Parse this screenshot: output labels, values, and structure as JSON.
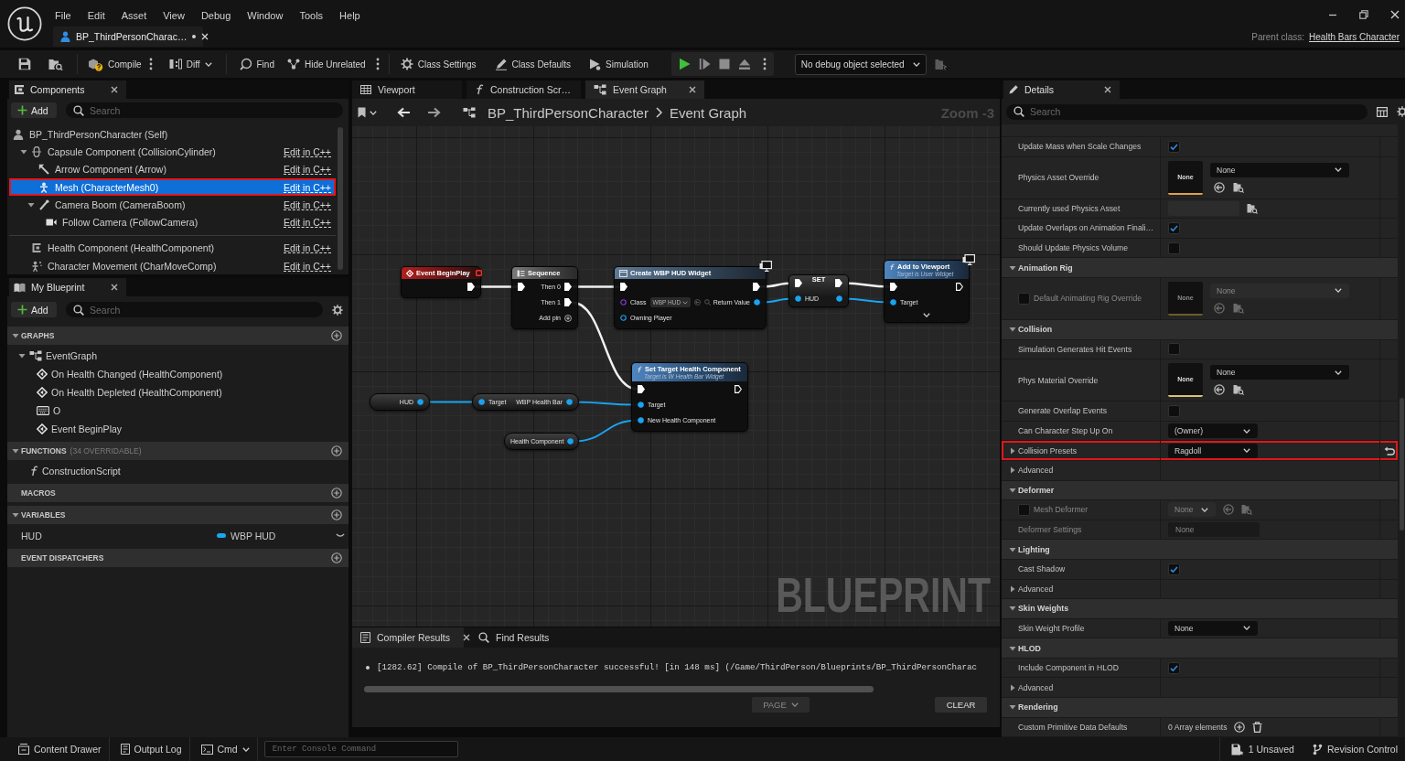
{
  "menu_bar": [
    "File",
    "Edit",
    "Asset",
    "View",
    "Debug",
    "Window",
    "Tools",
    "Help"
  ],
  "document_tab": {
    "label": "BP_ThirdPersonCharac…",
    "modified": true
  },
  "parent_class": {
    "label": "Parent class:",
    "value": "Health Bars Character"
  },
  "toolbar": {
    "compile": "Compile",
    "diff": "Diff",
    "find": "Find",
    "hide_unrelated": "Hide Unrelated",
    "class_settings": "Class Settings",
    "class_defaults": "Class Defaults",
    "simulation": "Simulation",
    "debug_object": "No debug object selected"
  },
  "components": {
    "tab": "Components",
    "add_button": "Add",
    "search_placeholder": "Search",
    "root": {
      "kind": "actor",
      "label": "BP_ThirdPersonCharacter (Self)",
      "selected": false,
      "outlined": false,
      "children": [
        {
          "kind": "capsule",
          "label": "Capsule Component (CollisionCylinder)",
          "link": "Edit in C++",
          "selected": false,
          "outlined": false,
          "expanded": true,
          "children": [
            {
              "kind": "arrow",
              "label": "Arrow Component (Arrow)",
              "link": "Edit in C++",
              "selected": false,
              "outlined": false
            },
            {
              "kind": "mesh",
              "label": "Mesh (CharacterMesh0)",
              "link": "Edit in C++",
              "selected": true,
              "outlined": true
            },
            {
              "kind": "boom",
              "label": "Camera Boom (CameraBoom)",
              "link": "Edit in C++",
              "selected": false,
              "outlined": false,
              "expanded": true,
              "children": [
                {
                  "kind": "camera",
                  "label": "Follow Camera (FollowCamera)",
                  "link": "Edit in C++",
                  "selected": false,
                  "outlined": false
                }
              ]
            }
          ]
        }
      ]
    },
    "actor_components": [
      {
        "kind": "health",
        "label": "Health Component (HealthComponent)",
        "link": "Edit in C++",
        "selected": false,
        "outlined": false
      },
      {
        "kind": "movement",
        "label": "Character Movement (CharMoveComp)",
        "link": "Edit in C++",
        "selected": false,
        "outlined": false
      }
    ]
  },
  "my_blueprint": {
    "tab": "My Blueprint",
    "add_button": "Add",
    "search_placeholder": "Search",
    "sections": [
      {
        "title": "GRAPHS",
        "expanded": true,
        "items": [
          {
            "kind": "graph",
            "label": "EventGraph",
            "expanded": true,
            "children": [
              {
                "kind": "event",
                "label": "On Health Changed (HealthComponent)"
              },
              {
                "kind": "event",
                "label": "On Health Depleted (HealthComponent)"
              },
              {
                "kind": "key",
                "label": "O"
              },
              {
                "kind": "event",
                "label": "Event BeginPlay"
              }
            ]
          }
        ]
      },
      {
        "title": "FUNCTIONS",
        "note": "(34 OVERRIDABLE)",
        "expanded": true,
        "items": [
          {
            "kind": "function",
            "label": "ConstructionScript"
          }
        ]
      },
      {
        "title": "MACROS"
      },
      {
        "title": "VARIABLES",
        "expanded": true,
        "items": [
          {
            "kind": "variable",
            "label": "HUD",
            "type": "WBP HUD",
            "color": "#1aa6ee"
          }
        ]
      },
      {
        "title": "EVENT DISPATCHERS"
      }
    ]
  },
  "graph_editor": {
    "tabs": [
      {
        "kind": "viewport",
        "label": "Viewport",
        "selected": false
      },
      {
        "kind": "function",
        "label": "Construction Scr…",
        "selected": false
      },
      {
        "kind": "graph",
        "label": "Event Graph",
        "selected": true
      }
    ],
    "breadcrumb": [
      "BP_ThirdPersonCharacter",
      "Event Graph"
    ],
    "zoom": "Zoom -3",
    "corner_label": "BLUEPRINT",
    "nodes": [
      {
        "kind": "event",
        "title": "Event BeginPlay",
        "outputs": [
          {
            "kind": "exec",
            "connected": true
          }
        ]
      },
      {
        "kind": "sequence",
        "title": "Sequence",
        "inputs": [
          {
            "kind": "exec",
            "connected": true
          }
        ],
        "outputs": [
          {
            "kind": "exec",
            "label": "Then 0",
            "connected": true
          },
          {
            "kind": "exec",
            "label": "Then 1",
            "connected": true
          }
        ],
        "add_pin": "Add pin"
      },
      {
        "kind": "create",
        "title": "Create WBP HUD Widget",
        "cosmetic": true,
        "inputs": [
          {
            "kind": "exec",
            "connected": true
          },
          {
            "kind": "class",
            "label": "Class",
            "value": "WBP HUD",
            "connected": false
          },
          {
            "kind": "object",
            "label": "Owning Player",
            "connected": false
          }
        ],
        "outputs": [
          {
            "kind": "exec",
            "connected": true
          },
          {
            "kind": "object",
            "label": "Return Value",
            "connected": true
          }
        ]
      },
      {
        "kind": "set",
        "title": "SET",
        "inputs": [
          {
            "kind": "exec",
            "connected": true
          },
          {
            "kind": "object",
            "label": "HUD",
            "connected": true
          }
        ],
        "outputs": [
          {
            "kind": "exec",
            "connected": true
          },
          {
            "kind": "object",
            "connected": true
          }
        ]
      },
      {
        "kind": "function",
        "title": "Add to Viewport",
        "subtitle": "Target is User Widget",
        "cosmetic": true,
        "advanced_expanded": false,
        "inputs": [
          {
            "kind": "exec",
            "connected": true
          },
          {
            "kind": "object",
            "label": "Target",
            "connected": true
          }
        ],
        "outputs": [
          {
            "kind": "exec",
            "connected": false
          }
        ]
      },
      {
        "kind": "function",
        "title": "Set Target Health Component",
        "subtitle": "Target is W Health Bar Widget",
        "cosmetic": false,
        "inputs": [
          {
            "kind": "exec",
            "connected": true
          },
          {
            "kind": "object",
            "label": "Target",
            "connected": true
          },
          {
            "kind": "object",
            "label": "New Health Component",
            "connected": true
          }
        ],
        "outputs": [
          {
            "kind": "exec",
            "connected": false
          }
        ]
      },
      {
        "kind": "getter",
        "outputs": [
          {
            "kind": "object",
            "label": "HUD",
            "connected": true
          }
        ]
      },
      {
        "kind": "getter",
        "inputs": [
          {
            "kind": "object",
            "label": "Target",
            "connected": true
          }
        ],
        "outputs": [
          {
            "kind": "object",
            "label": "WBP Health Bar",
            "connected": true
          }
        ]
      },
      {
        "kind": "getter",
        "outputs": [
          {
            "kind": "object",
            "label": "Health Component",
            "connected": true
          }
        ]
      }
    ]
  },
  "compiler_results": {
    "tabs": [
      {
        "kind": "results",
        "label": "Compiler Results",
        "selected": true
      },
      {
        "kind": "search",
        "label": "Find Results",
        "selected": false
      }
    ],
    "messages": [
      "[1282.62] Compile of BP_ThirdPersonCharacter successful! [in 148 ms] (/Game/ThirdPerson/Blueprints/BP_ThirdPersonCharac"
    ],
    "page_button": {
      "label": "PAGE",
      "disabled": true
    },
    "clear_button": "CLEAR"
  },
  "details": {
    "tab": "Details",
    "search_placeholder": "Search",
    "items": [
      {
        "kind": "checkbox",
        "label": "Update Mass when Scale Changes",
        "checked": true,
        "disabled": false,
        "outlined": false
      },
      {
        "kind": "asset",
        "label": "Physics Asset Override",
        "thumbnail": "None",
        "value": "None",
        "color": "#e3a04b",
        "disabled": false,
        "outlined": false
      },
      {
        "kind": "asset_path",
        "label": "Currently used Physics Asset",
        "disabled": false,
        "outlined": false
      },
      {
        "kind": "checkbox",
        "label": "Update Overlaps on Animation Finali…",
        "checked": true,
        "disabled": false,
        "outlined": false
      },
      {
        "kind": "checkbox",
        "label": "Should Update Physics Volume",
        "checked": false,
        "disabled": false,
        "outlined": false
      },
      {
        "kind": "section",
        "label": "Animation Rig",
        "expanded": true
      },
      {
        "kind": "asset",
        "label": "Default Animating Rig Override",
        "toggle": false,
        "thumbnail": "None",
        "value": "None",
        "color": "#6e5b2c",
        "disabled": true,
        "outlined": false
      },
      {
        "kind": "section",
        "label": "Collision",
        "expanded": true
      },
      {
        "kind": "checkbox",
        "label": "Simulation Generates Hit Events",
        "checked": false,
        "disabled": false,
        "outlined": false
      },
      {
        "kind": "asset",
        "label": "Phys Material Override",
        "thumbnail": "None",
        "value": "None",
        "color": "#d8c27c",
        "disabled": false,
        "outlined": false
      },
      {
        "kind": "checkbox",
        "label": "Generate Overlap Events",
        "checked": false,
        "disabled": false,
        "outlined": false
      },
      {
        "kind": "dropdown",
        "label": "Can Character Step Up On",
        "value": "(Owner)",
        "disabled": false,
        "outlined": false
      },
      {
        "kind": "dropdown",
        "label": "Collision Presets",
        "value": "Ragdoll",
        "expanded": false,
        "reset": true,
        "disabled": false,
        "outlined": true
      },
      {
        "kind": "group",
        "label": "Advanced",
        "expanded": false,
        "disabled": false,
        "outlined": false
      },
      {
        "kind": "section",
        "label": "Deformer",
        "expanded": true
      },
      {
        "kind": "asset_combo",
        "label": "Mesh Deformer",
        "toggle": false,
        "value": "None",
        "disabled": true,
        "outlined": false
      },
      {
        "kind": "text",
        "label": "Deformer Settings",
        "value": "None",
        "disabled": true,
        "outlined": false
      },
      {
        "kind": "section",
        "label": "Lighting",
        "expanded": true
      },
      {
        "kind": "checkbox",
        "label": "Cast Shadow",
        "checked": true,
        "disabled": false,
        "outlined": false
      },
      {
        "kind": "group",
        "label": "Advanced",
        "expanded": false,
        "disabled": false,
        "outlined": false
      },
      {
        "kind": "section",
        "label": "Skin Weights",
        "expanded": true
      },
      {
        "kind": "dropdown",
        "label": "Skin Weight Profile",
        "value": "None",
        "disabled": false,
        "outlined": false
      },
      {
        "kind": "section",
        "label": "HLOD",
        "expanded": true
      },
      {
        "kind": "checkbox",
        "label": "Include Component in HLOD",
        "checked": true,
        "disabled": false,
        "outlined": false
      },
      {
        "kind": "group",
        "label": "Advanced",
        "expanded": false,
        "disabled": false,
        "outlined": false
      },
      {
        "kind": "section",
        "label": "Rendering",
        "expanded": true
      },
      {
        "kind": "array",
        "label": "Custom Primitive Data Defaults",
        "value": "0 Array elements",
        "disabled": false,
        "outlined": false
      }
    ]
  },
  "status_bar": {
    "content_drawer": "Content Drawer",
    "output_log": "Output Log",
    "cmd": "Cmd",
    "console_placeholder": "Enter Console Command",
    "unsaved": "1 Unsaved",
    "revision_control": "Revision Control"
  }
}
